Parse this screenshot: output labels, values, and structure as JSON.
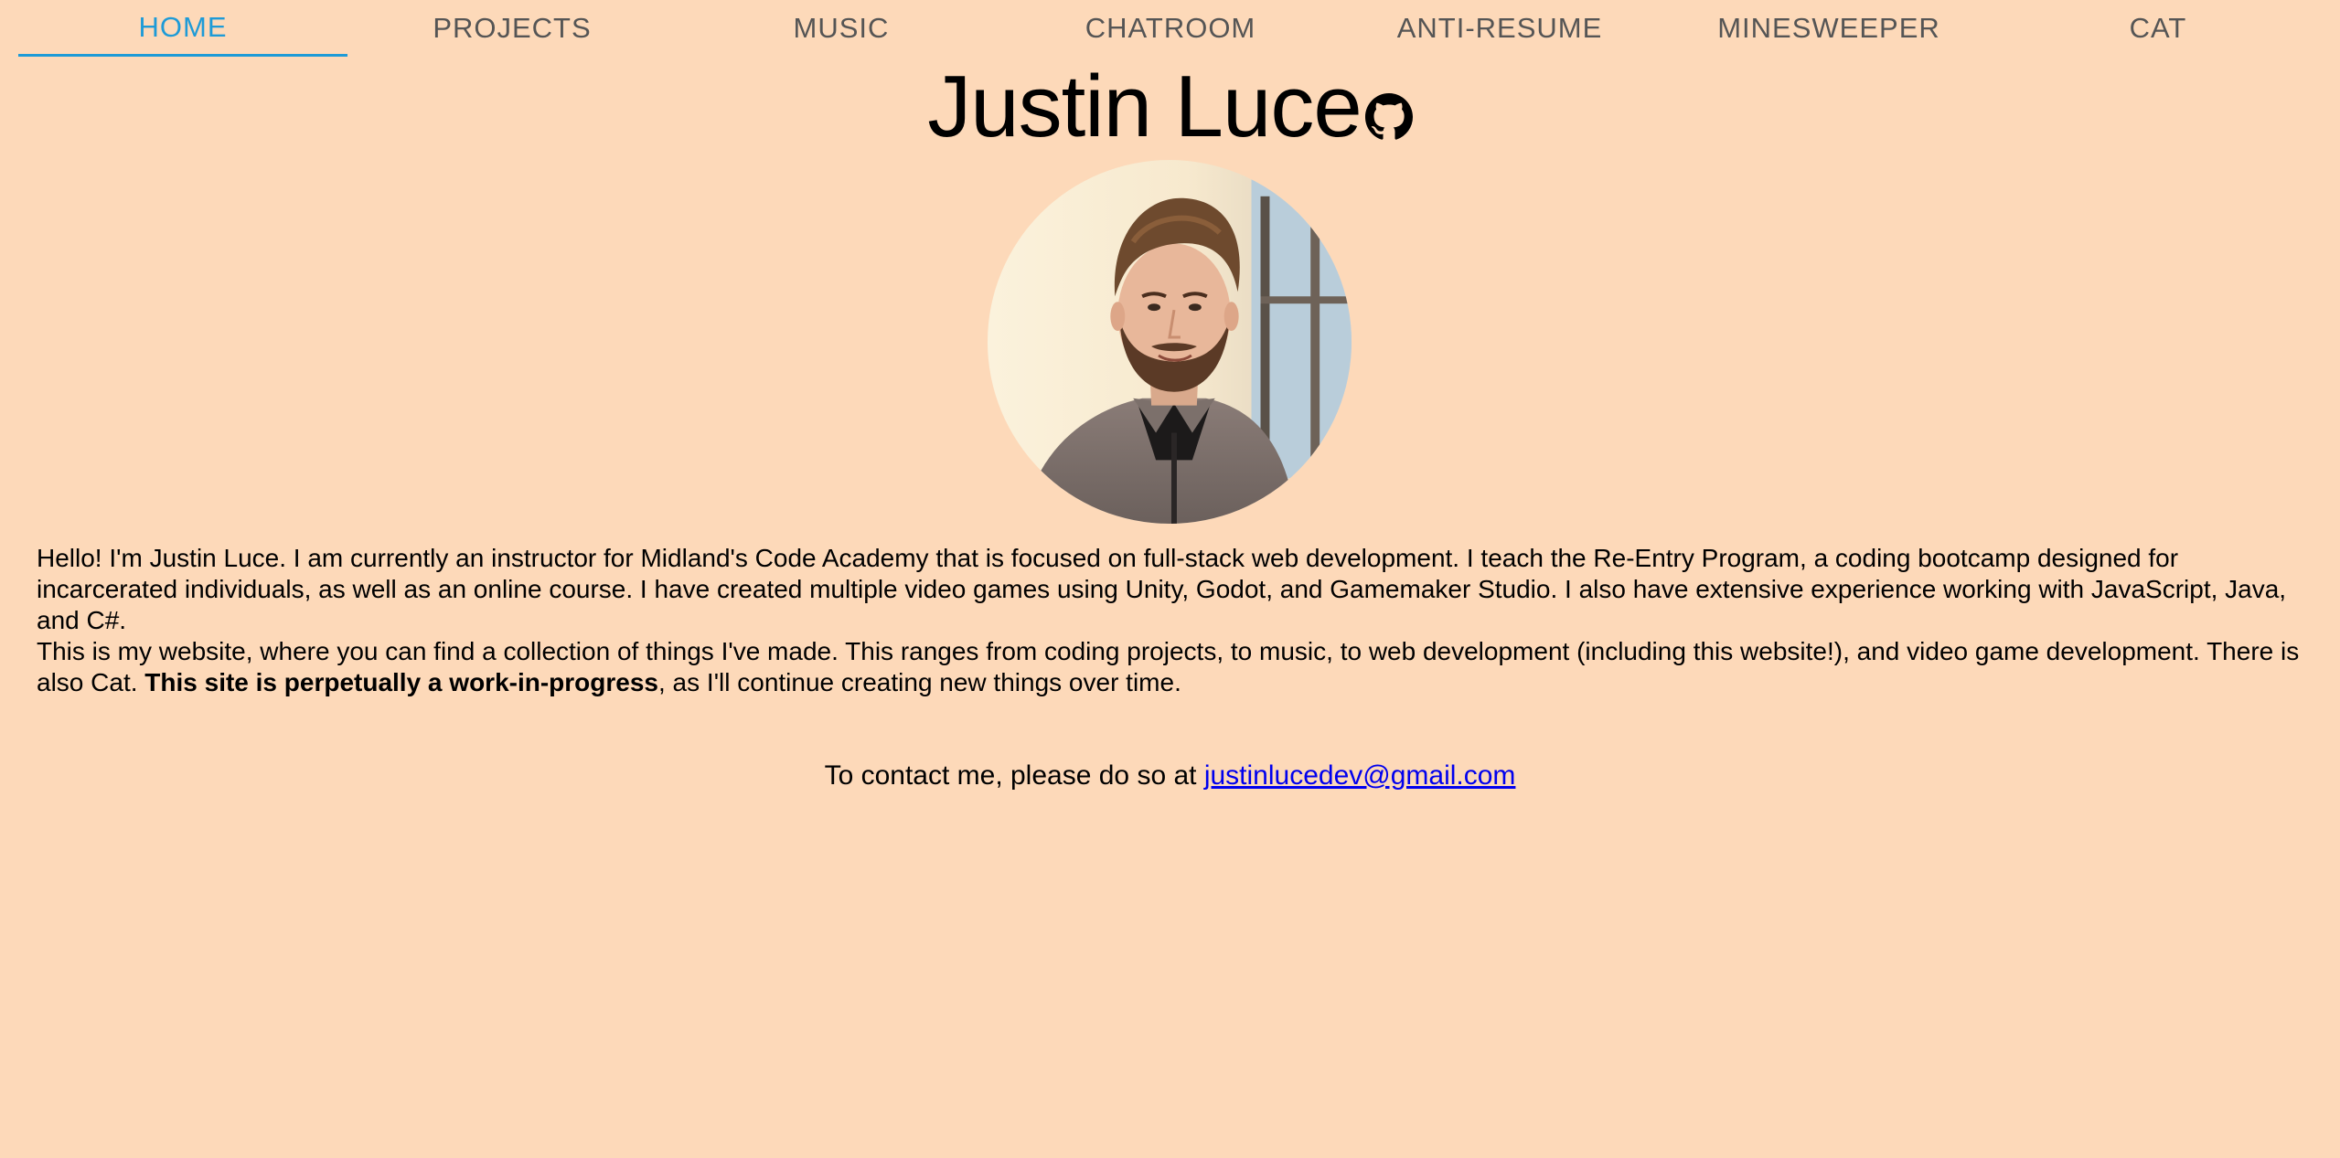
{
  "nav": {
    "items": [
      {
        "label": "HOME",
        "active": true
      },
      {
        "label": "PROJECTS"
      },
      {
        "label": "MUSIC"
      },
      {
        "label": "CHATROOM"
      },
      {
        "label": "ANTI-RESUME"
      },
      {
        "label": "MINESWEEPER"
      },
      {
        "label": "CAT"
      }
    ]
  },
  "header": {
    "title": "Justin Luce",
    "github_icon": "github-icon"
  },
  "profile": {
    "photo_icon": "profile-photo"
  },
  "bio": {
    "paragraph1": "Hello! I'm Justin Luce. I am currently an instructor for Midland's Code Academy that is focused on full-stack web development. I teach the Re-Entry Program, a coding bootcamp designed for incarcerated individuals, as well as an online course. I have created multiple video games using Unity, Godot, and Gamemaker Studio. I also have extensive experience working with JavaScript, Java, and C#.",
    "paragraph2_start": "This is my website, where you can find a collection of things I've made. This ranges from coding projects, to music, to web development (including this website!), and video game development. There is also Cat. ",
    "paragraph2_bold": "This site is perpetually a work-in-progress",
    "paragraph2_end": ", as I'll continue creating new things over time."
  },
  "contact": {
    "prefix": "To contact me, please do so at ",
    "email": "justinlucedev@gmail.com"
  },
  "colors": {
    "background": "#FDD9B9",
    "nav_active": "#1E9BD7",
    "nav_inactive": "#555555",
    "link": "#0000EE"
  }
}
